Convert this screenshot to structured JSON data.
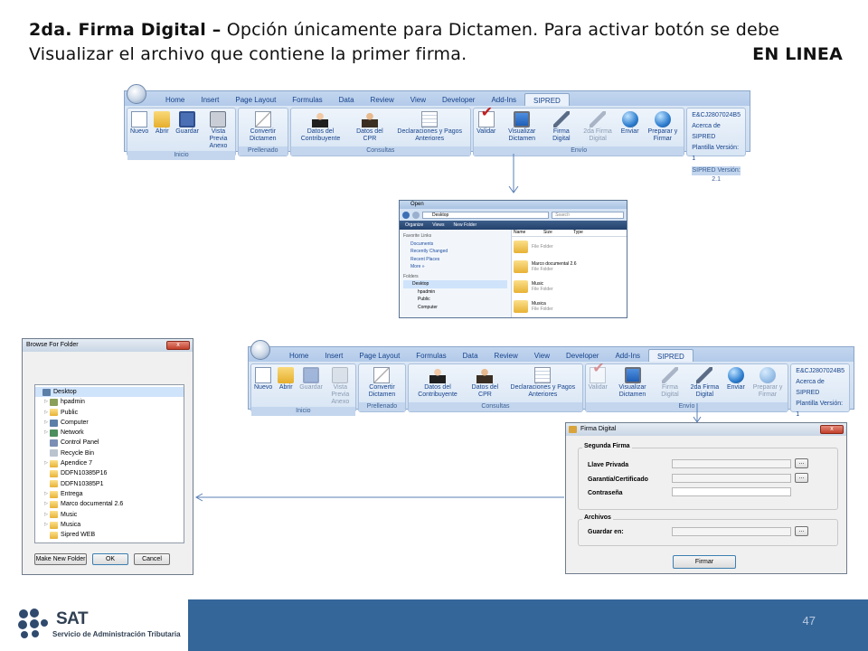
{
  "slide": {
    "title_bold": "2da. Firma Digital –",
    "title_text": " Opción únicamente para Dictamen. Para activar botón se debe Visualizar el archivo que contiene la primer firma.",
    "title_tag": "EN LINEA",
    "page_number": "47"
  },
  "ribbon": {
    "tabs": [
      "Home",
      "Insert",
      "Page Layout",
      "Formulas",
      "Data",
      "Review",
      "View",
      "Developer",
      "Add-Ins",
      "SIPRED"
    ],
    "active_tab": "SIPRED",
    "groups": {
      "inicio": {
        "name": "Inicio",
        "buttons": [
          "Nuevo",
          "Abrir",
          "Guardar",
          "Vista Previa Anexo"
        ]
      },
      "prellenado": {
        "name": "Prellenado",
        "buttons": [
          "Convertir Dictamen"
        ]
      },
      "consultas": {
        "name": "Consultas",
        "buttons": [
          "Datos del Contribuyente",
          "Datos del CPR",
          "Declaraciones y Pagos Anteriores"
        ]
      },
      "envio": {
        "name": "Envío",
        "buttons": [
          "Validar",
          "Visualizar Dictamen",
          "Firma Digital",
          "2da Firma Digital",
          "Enviar",
          "Preparar y Firmar"
        ]
      }
    },
    "info": {
      "rfc": "E&CJ2807024B5",
      "about": "Acerca de SIPRED",
      "plantilla": "Plantilla Versión: 1",
      "version": "SIPRED Versión: 2.1"
    }
  },
  "explorer": {
    "title": "Open",
    "address": "Desktop",
    "search_placeholder": "Search",
    "commands": [
      "Organize",
      "Views",
      "New Folder"
    ],
    "favorite_links_label": "Favorite Links",
    "favorites": [
      "Documents",
      "Recently Changed",
      "Recent Places",
      "More »"
    ],
    "folders_label": "Folders",
    "folders": [
      "Desktop",
      "hpadmin",
      "Public",
      "Computer"
    ],
    "columns": [
      "Name",
      "Size",
      "Type"
    ],
    "files": [
      {
        "name": "",
        "type": "File Folder"
      },
      {
        "name": "Marco documental 2.6",
        "type": "File Folder"
      },
      {
        "name": "Music",
        "type": "File Folder"
      },
      {
        "name": "Musica",
        "type": "File Folder"
      }
    ]
  },
  "browse": {
    "title": "Browse For Folder",
    "close": "x",
    "items": [
      {
        "label": "Desktop",
        "icon": "desktop-icon"
      },
      {
        "label": "hpadmin",
        "icon": "user-folder-icon"
      },
      {
        "label": "Public",
        "icon": "folder-icon"
      },
      {
        "label": "Computer",
        "icon": "computer-icon"
      },
      {
        "label": "Network",
        "icon": "network-icon"
      },
      {
        "label": "Control Panel",
        "icon": "control-panel-icon"
      },
      {
        "label": "Recycle Bin",
        "icon": "recycle-bin-icon"
      },
      {
        "label": "Apendice 7",
        "icon": "folder-icon"
      },
      {
        "label": "DDFN10385P16",
        "icon": "folder-icon"
      },
      {
        "label": "DDFN10385P1",
        "icon": "folder-icon"
      },
      {
        "label": "Entrega",
        "icon": "folder-icon"
      },
      {
        "label": "Marco documental 2.6",
        "icon": "folder-icon"
      },
      {
        "label": "Music",
        "icon": "folder-icon"
      },
      {
        "label": "Musica",
        "icon": "folder-icon"
      },
      {
        "label": "Sipred WEB",
        "icon": "folder-icon"
      }
    ],
    "buttons": {
      "new_folder": "Make New Folder",
      "ok": "OK",
      "cancel": "Cancel"
    }
  },
  "firma": {
    "title": "Firma Digital",
    "close": "x",
    "segunda_legend": "Segunda Firma",
    "llave_label": "Llave Privada",
    "certificado_label": "Garantía/Certificado",
    "contrasena_label": "Contraseña",
    "archivos_legend": "Archivos",
    "guardar_label": "Guardar en:",
    "browse": "...",
    "firmar": "Firmar"
  },
  "logo": {
    "name": "SAT",
    "subtitle": "Servicio de Administración Tributaria"
  },
  "colors": {
    "footer_bar": "#356699",
    "ribbon_text": "#15428b",
    "arrow": "#5a7fb5"
  }
}
